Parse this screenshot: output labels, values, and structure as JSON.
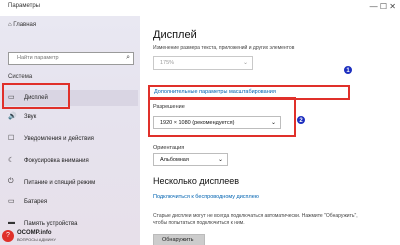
{
  "window": {
    "title": "Параметры",
    "controls": "—  ☐  ✕"
  },
  "sidebar": {
    "home_label": "⌂  Главная",
    "search_placeholder": "Найти параметр",
    "section": "Система",
    "items": [
      {
        "icon": "monitor-icon",
        "glyph": "▭",
        "label": "Дисплей"
      },
      {
        "icon": "sound-icon",
        "glyph": "🔊",
        "label": "Звук"
      },
      {
        "icon": "notifications-icon",
        "glyph": "☐",
        "label": "Уведомления и действия"
      },
      {
        "icon": "focus-assist-icon",
        "glyph": "☾",
        "label": "Фокусировка внимания"
      },
      {
        "icon": "power-icon",
        "glyph": "⏻",
        "label": "Питание и спящий режим"
      },
      {
        "icon": "battery-icon",
        "glyph": "▭",
        "label": "Батарея"
      },
      {
        "icon": "storage-icon",
        "glyph": "▬",
        "label": "Память устройства"
      }
    ]
  },
  "main": {
    "title": "Дисплей",
    "scale_caption": "Изменение размера текста, приложений и других элементов",
    "scale_value": "175%",
    "advanced_link": "Дополнительные параметры масштабирования",
    "resolution_label": "Разрешение",
    "resolution_value": "1920 × 1080 (рекомендуется)",
    "orientation_label": "Ориентация",
    "orientation_value": "Альбомная",
    "multi_title": "Несколько дисплеев",
    "wireless_link": "Подключиться к беспроводному дисплею",
    "description": "Старые дисплеи могут не всегда подключаться автоматически. Нажмите \"Обнаружить\", чтобы попытаться подключиться к ним.",
    "detect_button": "Обнаружить"
  },
  "callouts": [
    "1",
    "2"
  ],
  "colors": {
    "accent": "#0063b1",
    "highlight_red": "#e0302a",
    "badge_blue": "#1d2fbf"
  },
  "watermark": {
    "line1": "OCOMP.info",
    "line2": "ВОПРОСЫ АДМИНУ"
  }
}
